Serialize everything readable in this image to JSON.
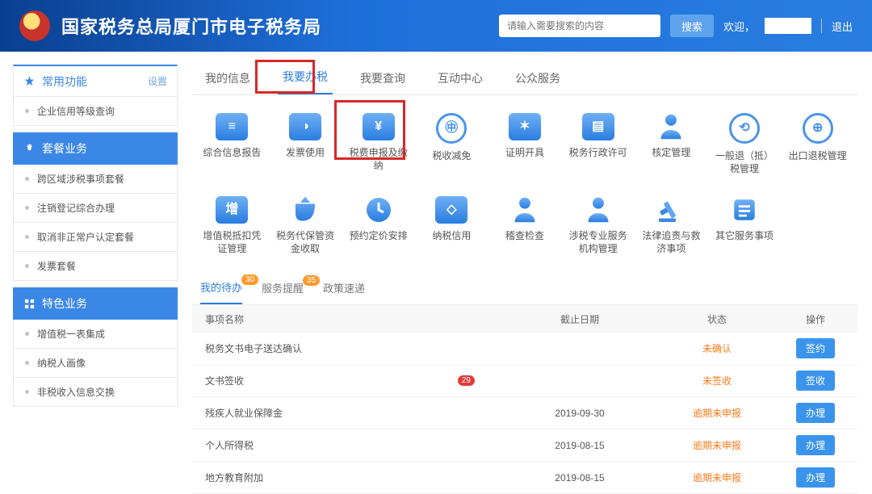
{
  "header": {
    "site_title": "国家税务总局厦门市电子税务局",
    "search_placeholder": "请输入需要搜索的内容",
    "search_btn": "搜索",
    "welcome": "欢迎，",
    "logout": "退出"
  },
  "sidebar": {
    "group1": {
      "title": "常用功能",
      "settings": "设置",
      "items": [
        "企业信用等级查询"
      ]
    },
    "group2": {
      "title": "套餐业务",
      "items": [
        "跨区域涉税事项套餐",
        "注销登记综合办理",
        "取消非正常户认定套餐",
        "发票套餐"
      ]
    },
    "group3": {
      "title": "特色业务",
      "items": [
        "增值税一表集成",
        "纳税人画像",
        "非税收入信息交换"
      ]
    }
  },
  "tabs": [
    "我的信息",
    "我要办税",
    "我要查询",
    "互动中心",
    "公众服务"
  ],
  "active_tab": 1,
  "icons_row1": [
    {
      "label": "综合信息报告",
      "glyph": "≡"
    },
    {
      "label": "发票使用",
      "glyph": "◑"
    },
    {
      "label": "税费申报及缴纳",
      "glyph": "¥"
    },
    {
      "label": "税收减免",
      "glyph": "㊥",
      "round": true
    },
    {
      "label": "证明开具",
      "glyph": "✶"
    },
    {
      "label": "税务行政许可",
      "glyph": "▤"
    },
    {
      "label": "核定管理",
      "glyph": "person"
    },
    {
      "label": "一般退（抵）税管理",
      "glyph": "⟲",
      "round": true
    },
    {
      "label": "出口退税管理",
      "glyph": "⊕",
      "round": true
    }
  ],
  "icons_row2": [
    {
      "label": "增值税抵扣凭证管理",
      "glyph": "增"
    },
    {
      "label": "税务代保管资金收取",
      "glyph": "bag"
    },
    {
      "label": "预约定价安排",
      "glyph": "clock"
    },
    {
      "label": "纳税信用",
      "glyph": "◇"
    },
    {
      "label": "稽查检查",
      "glyph": "person2"
    },
    {
      "label": "涉税专业服务机构管理",
      "glyph": "person3"
    },
    {
      "label": "法律追责与救济事项",
      "glyph": "gavel"
    },
    {
      "label": "其它服务事项",
      "glyph": "list"
    }
  ],
  "sub_tabs": [
    {
      "label": "我的待办",
      "badge": "30"
    },
    {
      "label": "服务提醒",
      "badge": "35"
    },
    {
      "label": "政策速递"
    }
  ],
  "active_sub_tab": 0,
  "table": {
    "headers": [
      "事项名称",
      "截止日期",
      "状态",
      "操作"
    ],
    "rows": [
      {
        "name": "税务文书电子送达确认",
        "due": "",
        "status": "未确认",
        "op": "签约"
      },
      {
        "name": "文书签收",
        "badge": "29",
        "due": "",
        "status": "未签收",
        "op": "签收"
      },
      {
        "name": "残疾人就业保障金",
        "due": "2019-09-30",
        "status": "逾期未申报",
        "op": "办理"
      },
      {
        "name": "个人所得税",
        "due": "2019-08-15",
        "status": "逾期未申报",
        "op": "办理"
      },
      {
        "name": "地方教育附加",
        "due": "2019-08-15",
        "status": "逾期未申报",
        "op": "办理"
      }
    ]
  }
}
